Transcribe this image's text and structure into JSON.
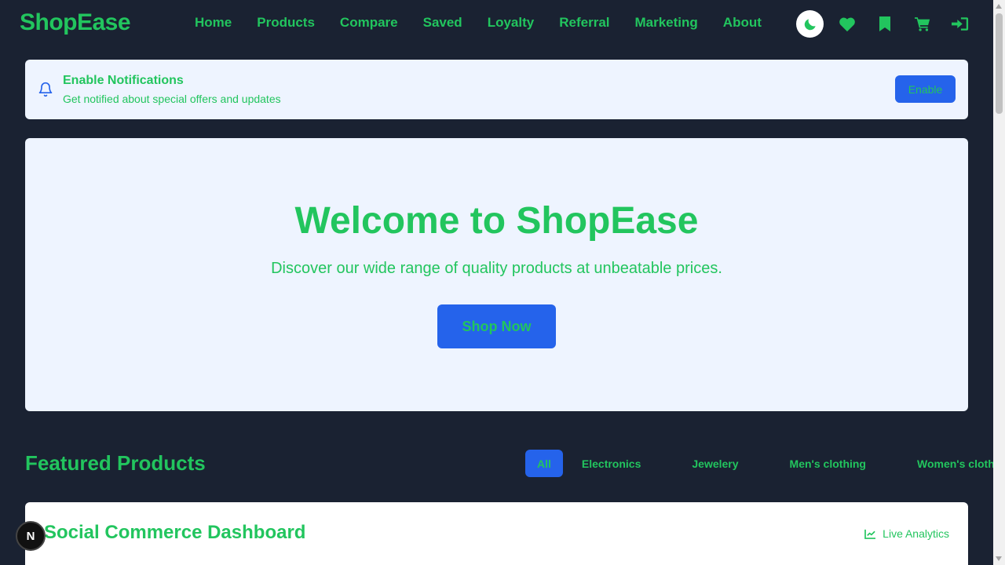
{
  "brand": "ShopEase",
  "nav": {
    "links": [
      "Home",
      "Products",
      "Compare",
      "Saved",
      "Loyalty",
      "Referral",
      "Marketing",
      "About"
    ],
    "icons": [
      "moon-icon",
      "heart-icon",
      "bookmark-icon",
      "cart-icon",
      "sign-in-icon"
    ]
  },
  "notification": {
    "title": "Enable Notifications",
    "subtitle": "Get notified about special offers and updates",
    "button": "Enable"
  },
  "hero": {
    "title": "Welcome to ShopEase",
    "subtitle": "Discover our wide range of quality products at unbeatable prices.",
    "button": "Shop Now"
  },
  "featured": {
    "title": "Featured Products",
    "filters": [
      "All",
      "Electronics",
      "Jewelery",
      "Men's clothing",
      "Women's clothing"
    ],
    "active_filter": "All"
  },
  "dashboard": {
    "title": "Social Commerce Dashboard",
    "live_label": "Live Analytics"
  },
  "floating_badge": "N",
  "colors": {
    "background": "#1a2232",
    "accent_green": "#22c55e",
    "primary_blue": "#2563eb",
    "panel_bg": "#eef4ff"
  }
}
